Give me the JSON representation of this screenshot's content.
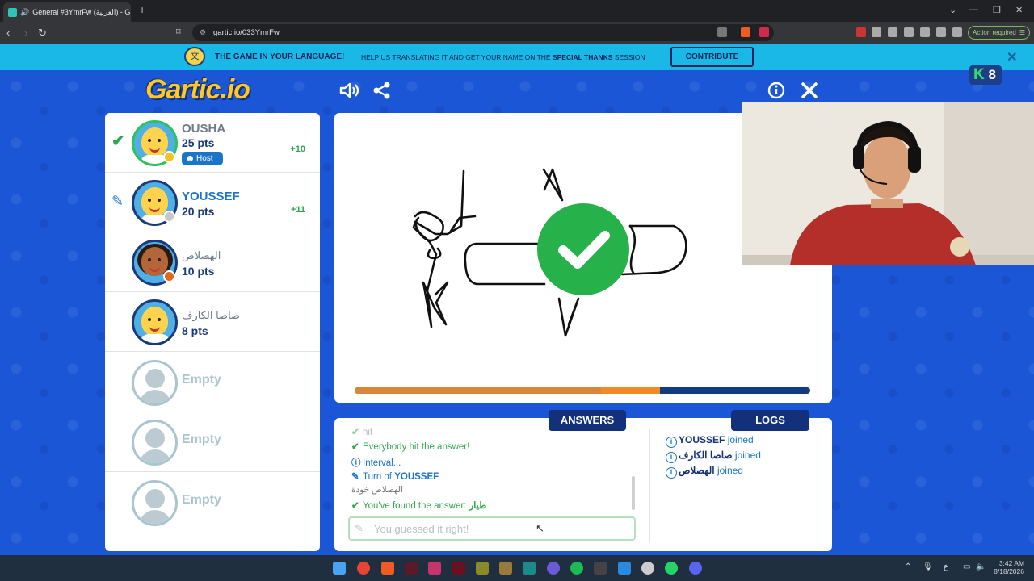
{
  "browser": {
    "tab_title": "General #3YmrFw (العربية) - G",
    "tab_close": "×",
    "new_tab": "+",
    "url": "gartic.io/033YmrFw",
    "action_required": "Action required"
  },
  "banner": {
    "title": "THE GAME IN YOUR LANGUAGE!",
    "text_before": "HELP US TRANSLATING IT AND GET YOUR NAME ON THE",
    "text_link": "SPECIAL THANKS",
    "text_after": "SESSION",
    "contribute_label": "CONTRIBUTE",
    "close": "✕"
  },
  "game": {
    "logo": "Gartic.io",
    "badge_letter": "K",
    "badge_count": "8"
  },
  "players": [
    {
      "name": "OUSHA",
      "points": "25 pts",
      "bonus": "+10",
      "host_label": "Host",
      "status_color": "#f5c31b",
      "guessed": true
    },
    {
      "name": "YOUSSEF",
      "points": "20 pts",
      "bonus": "+11",
      "status_color": "#c8c8c8",
      "drawing": true
    },
    {
      "name": "الهصلاص",
      "points": "10 pts",
      "status_color": "#e06a1a"
    },
    {
      "name": "صاصا الكارف",
      "points": "8 pts"
    },
    {
      "name": "Empty"
    },
    {
      "name": "Empty"
    },
    {
      "name": "Empty"
    }
  ],
  "round": {
    "timer_progress": 0.67,
    "timer_elapsed_marker": 0.54
  },
  "tabs": {
    "answers": "ANSWERS",
    "logs": "LOGS"
  },
  "answers": {
    "cut_line": "hit",
    "everybody_hit": "Everybody hit the answer!",
    "interval": "Interval...",
    "turn_prefix": "Turn of",
    "turn_player": "YOUSSEF",
    "chat_line": "الهصلاص خودة",
    "found_prefix": "You've found the answer:",
    "found_word": "طيار",
    "guess_placeholder": "You guessed it right!"
  },
  "logs": [
    {
      "player": "YOUSSEF",
      "action": "joined"
    },
    {
      "player": "صاصا الكارف",
      "action": "joined"
    },
    {
      "player": "الهصلاص",
      "action": "joined"
    }
  ],
  "system": {
    "time": "3:42 AM",
    "date": "8/18/2026",
    "lang": "ع"
  },
  "colors": {
    "background": "#1a56d6",
    "banner": "#19b8e6",
    "accent_green": "#2ea84f",
    "accent_blue": "#1a74c8",
    "dark_navy": "#13307a",
    "timer_fill": "#f08a24"
  }
}
